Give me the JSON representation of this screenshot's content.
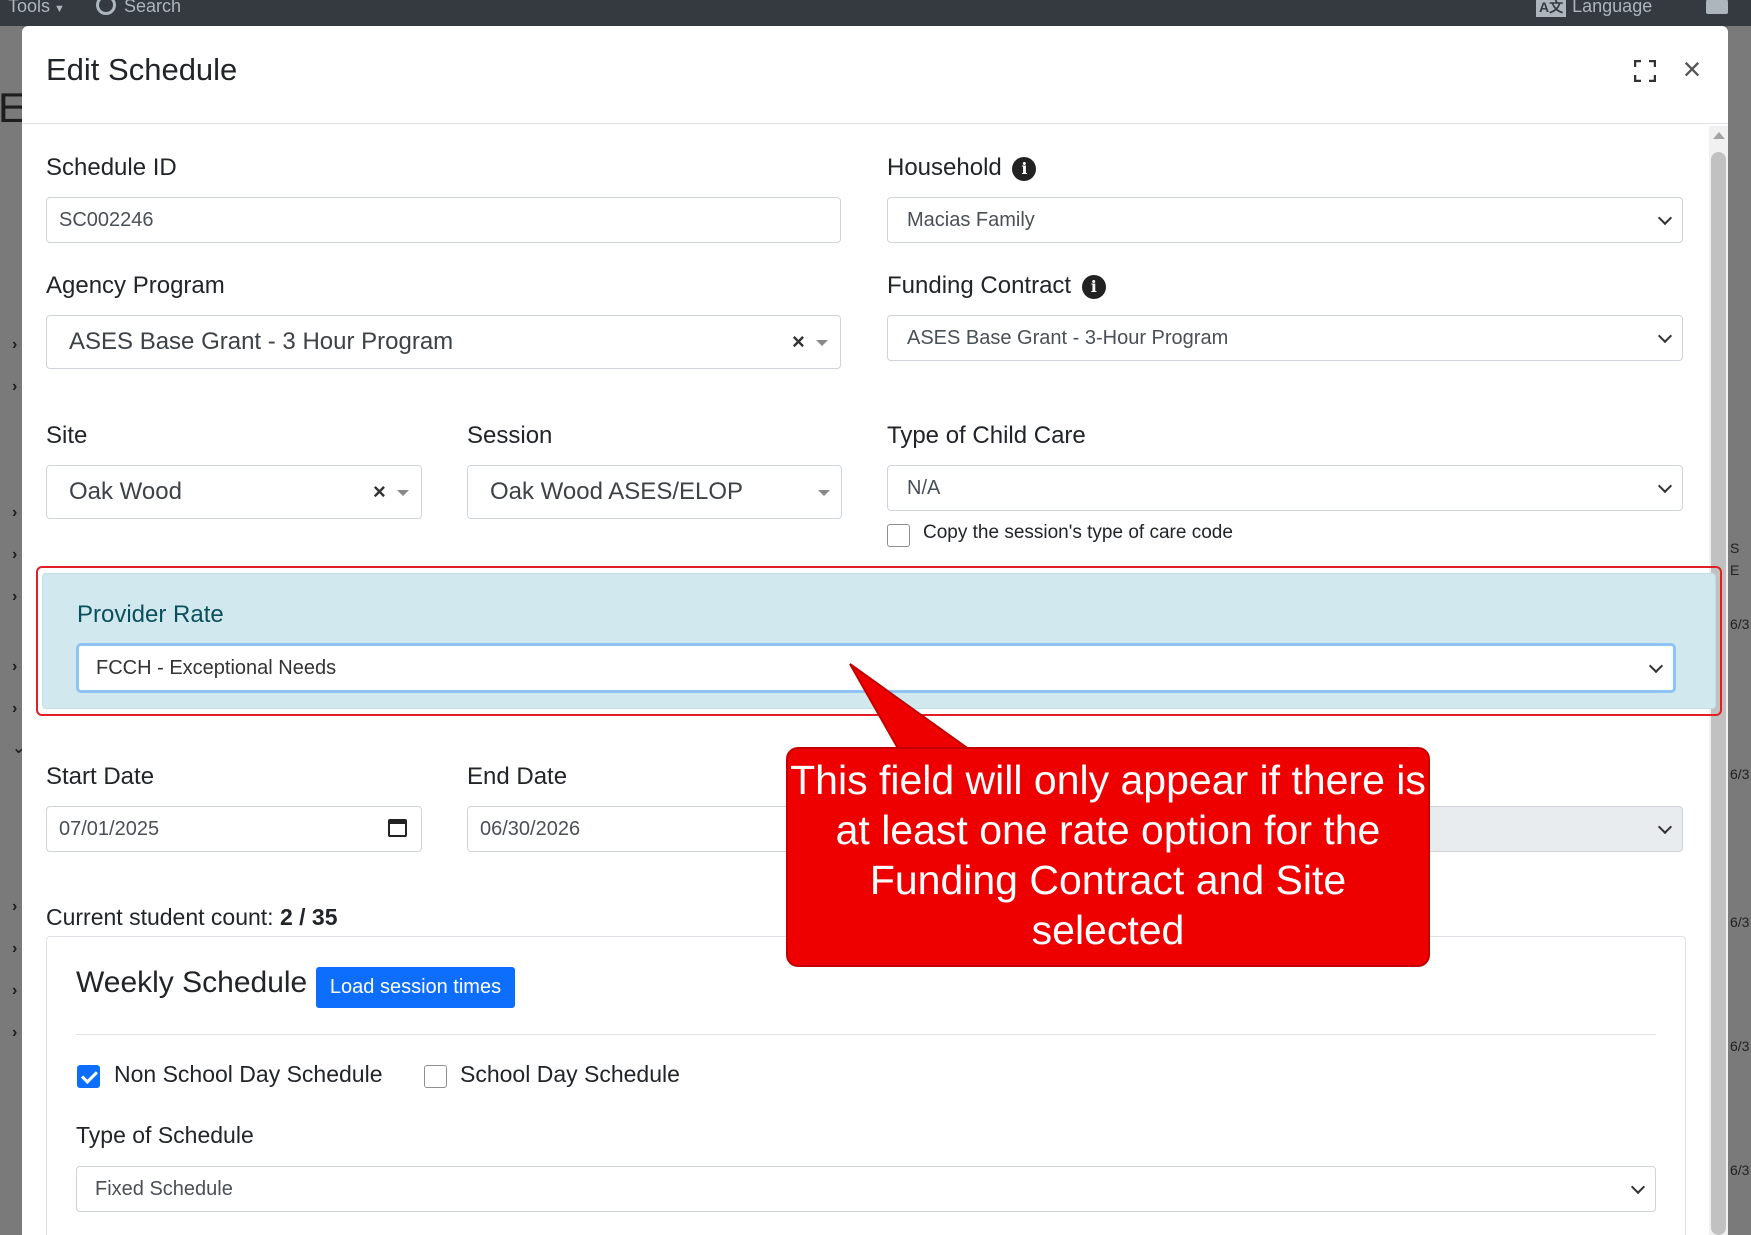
{
  "topbar": {
    "tools_label": "Tools",
    "search_label": "Search",
    "language_label": "Language"
  },
  "background": {
    "heading_letter": "E",
    "right_cells": [
      "S",
      "E",
      "6/3",
      "6/3",
      "6/3",
      "6/3",
      "6/3"
    ]
  },
  "modal": {
    "title": "Edit Schedule"
  },
  "form": {
    "schedule_id": {
      "label": "Schedule ID",
      "value": "SC002246"
    },
    "household": {
      "label": "Household",
      "value": "Macias Family"
    },
    "agency_program": {
      "label": "Agency Program",
      "value": "ASES Base Grant - 3 Hour Program"
    },
    "funding_contract": {
      "label": "Funding Contract",
      "value": "ASES Base Grant - 3-Hour Program"
    },
    "site": {
      "label": "Site",
      "value": "Oak Wood"
    },
    "session": {
      "label": "Session",
      "value": "Oak Wood ASES/ELOP"
    },
    "type_of_child_care": {
      "label": "Type of Child Care",
      "value": "N/A"
    },
    "copy_care_code": {
      "label": "Copy the session's type of care code",
      "checked": false
    },
    "provider_rate": {
      "label": "Provider Rate",
      "value": "FCCH - Exceptional Needs"
    },
    "start_date": {
      "label": "Start Date",
      "value": "07/01/2025"
    },
    "end_date": {
      "label": "End Date",
      "value": "06/30/2026"
    },
    "student_count": {
      "label": "Current student count:",
      "value": "2 / 35"
    }
  },
  "weekly": {
    "title": "Weekly Schedule",
    "load_button": "Load session times",
    "non_school_day": {
      "label": "Non School Day Schedule",
      "checked": true
    },
    "school_day": {
      "label": "School Day Schedule",
      "checked": false
    },
    "type_of_schedule": {
      "label": "Type of Schedule",
      "value": "Fixed Schedule"
    }
  },
  "annotation": {
    "text": "This field will only appear if there is at least one rate option for the Funding Contract and Site selected"
  },
  "colors": {
    "primary": "#0d6efd",
    "highlight_panel": "#d1e9ee",
    "annotation_red": "#ee0000",
    "outline_red": "#e21f26"
  }
}
